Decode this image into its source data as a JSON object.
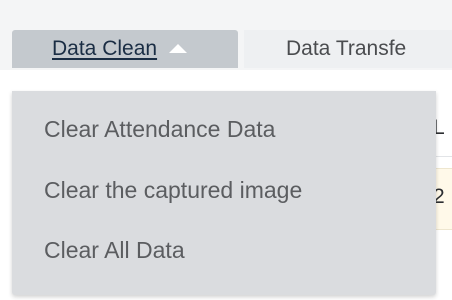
{
  "tabs": {
    "data_clean": "Data Clean",
    "data_transfer": "Data Transfe"
  },
  "dropdown": {
    "items": [
      "Clear Attendance Data",
      "Clear the captured image",
      "Clear All Data"
    ]
  },
  "table": {
    "header_partial": "L",
    "row_partial": "2"
  },
  "colors": {
    "active_tab": "#c4c9ce",
    "dropdown_bg": "#dadcdf",
    "highlight_row": "#fff9e9"
  }
}
